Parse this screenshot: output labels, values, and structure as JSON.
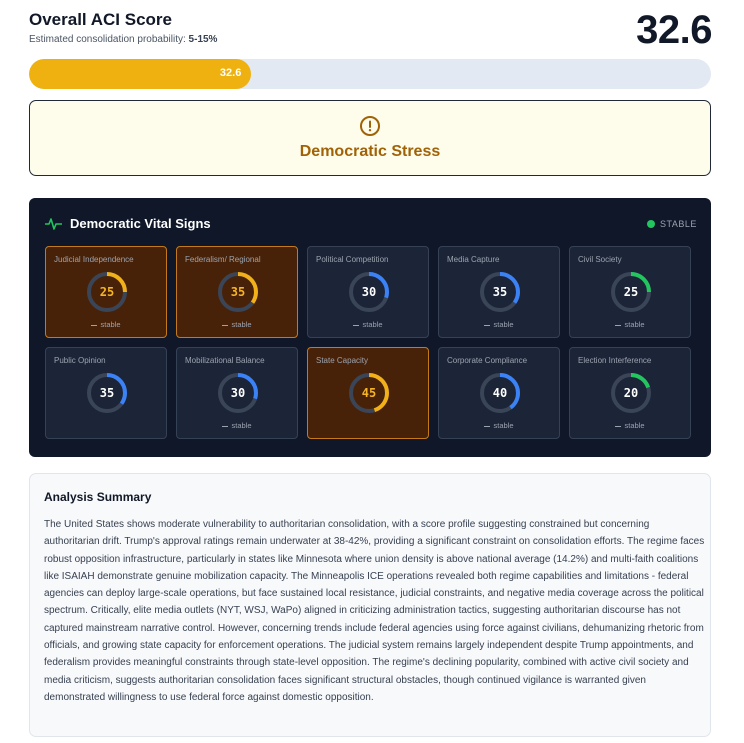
{
  "header": {
    "title": "Overall ACI Score",
    "subtitle_prefix": "Estimated consolidation probability:",
    "probability": "5-15%",
    "score": "32.6"
  },
  "score_bar": {
    "label": "32.6",
    "fraction": 0.326,
    "color": "#efb10f"
  },
  "alert": {
    "icon": "alert-circle-icon",
    "text": "Democratic Stress"
  },
  "vitals": {
    "title": "Democratic Vital Signs",
    "icon": "activity-pulse-icon",
    "status": "STABLE",
    "status_color": "#22c55e",
    "cards": [
      {
        "label": "Judicial Independence",
        "value": "25",
        "trend": "stable",
        "warn": true,
        "arc_color": "#f2b019"
      },
      {
        "label": "Federalism/ Regional",
        "value": "35",
        "trend": "stable",
        "warn": true,
        "arc_color": "#f2b019"
      },
      {
        "label": "Political Competition",
        "value": "30",
        "trend": "stable",
        "warn": false,
        "arc_color": "#3b82f6"
      },
      {
        "label": "Media Capture",
        "value": "35",
        "trend": "stable",
        "warn": false,
        "arc_color": "#3b82f6"
      },
      {
        "label": "Civil Society",
        "value": "25",
        "trend": "stable",
        "warn": false,
        "arc_color": "#22c55e"
      },
      {
        "label": "Public Opinion",
        "value": "35",
        "trend": "",
        "warn": false,
        "arc_color": "#3b82f6"
      },
      {
        "label": "Mobilizational Balance",
        "value": "30",
        "trend": "stable",
        "warn": false,
        "arc_color": "#3b82f6"
      },
      {
        "label": "State Capacity",
        "value": "45",
        "trend": "",
        "warn": true,
        "arc_color": "#f2b019"
      },
      {
        "label": "Corporate Compliance",
        "value": "40",
        "trend": "stable",
        "warn": false,
        "arc_color": "#3b82f6"
      },
      {
        "label": "Election Interference",
        "value": "20",
        "trend": "stable",
        "warn": false,
        "arc_color": "#22c55e"
      }
    ]
  },
  "summary": {
    "title": "Analysis Summary",
    "body": "The United States shows moderate vulnerability to authoritarian consolidation, with a score profile suggesting constrained but concerning authoritarian drift. Trump's approval ratings remain underwater at 38-42%, providing a significant constraint on consolidation efforts. The regime faces robust opposition infrastructure, particularly in states like Minnesota where union density is above national average (14.2%) and multi-faith coalitions like ISAIAH demonstrate genuine mobilization capacity. The Minneapolis ICE operations revealed both regime capabilities and limitations - federal agencies can deploy large-scale operations, but face sustained local resistance, judicial constraints, and negative media coverage across the political spectrum. Critically, elite media outlets (NYT, WSJ, WaPo) aligned in criticizing administration tactics, suggesting authoritarian discourse has not captured mainstream narrative control. However, concerning trends include federal agencies using force against civilians, dehumanizing rhetoric from officials, and growing state capacity for enforcement operations. The judicial system remains largely independent despite Trump appointments, and federalism provides meaningful constraints through state-level opposition. The regime's declining popularity, combined with active civil society and media criticism, suggests authoritarian consolidation faces significant structural obstacles, though continued vigilance is warranted given demonstrated willingness to use federal force against domestic opposition."
  }
}
